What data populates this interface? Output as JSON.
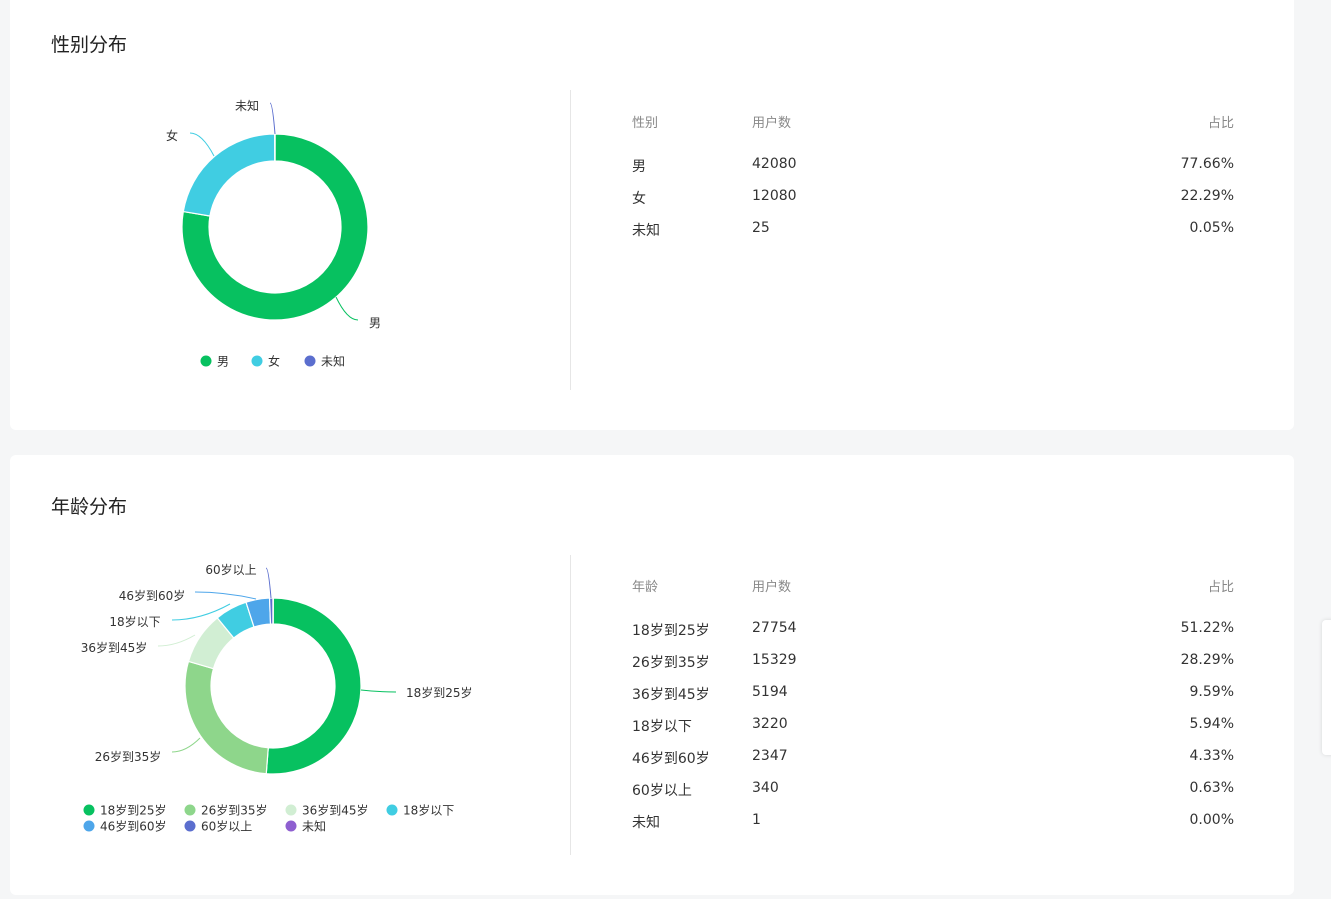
{
  "gender_section": {
    "title": "性别分布",
    "table": {
      "headers": [
        "性别",
        "用户数",
        "占比"
      ],
      "rows": [
        [
          "男",
          "42080",
          "77.66%"
        ],
        [
          "女",
          "12080",
          "22.29%"
        ],
        [
          "未知",
          "25",
          "0.05%"
        ]
      ]
    }
  },
  "age_section": {
    "title": "年龄分布",
    "table": {
      "headers": [
        "年龄",
        "用户数",
        "占比"
      ],
      "rows": [
        [
          "18岁到25岁",
          "27754",
          "51.22%"
        ],
        [
          "26岁到35岁",
          "15329",
          "28.29%"
        ],
        [
          "36岁到45岁",
          "5194",
          "9.59%"
        ],
        [
          "18岁以下",
          "3220",
          "5.94%"
        ],
        [
          "46岁到60岁",
          "2347",
          "4.33%"
        ],
        [
          "60岁以上",
          "340",
          "0.63%"
        ],
        [
          "未知",
          "1",
          "0.00%"
        ]
      ]
    }
  },
  "chart_data": [
    {
      "type": "pie",
      "title": "性别分布",
      "categories": [
        "男",
        "女",
        "未知"
      ],
      "values": [
        42080,
        12080,
        25
      ],
      "colors": [
        "#07c160",
        "#40cde2",
        "#5b6ece"
      ],
      "legend": "bottom"
    },
    {
      "type": "pie",
      "title": "年龄分布",
      "categories": [
        "18岁到25岁",
        "26岁到35岁",
        "36岁到45岁",
        "18岁以下",
        "46岁到60岁",
        "60岁以上",
        "未知"
      ],
      "values": [
        27754,
        15329,
        5194,
        3220,
        2347,
        340,
        1
      ],
      "colors": [
        "#07c160",
        "#8ed68b",
        "#d1eed3",
        "#40cde2",
        "#4ea6ea",
        "#5b6ece",
        "#8e5fd0"
      ],
      "legend": "bottom"
    }
  ]
}
